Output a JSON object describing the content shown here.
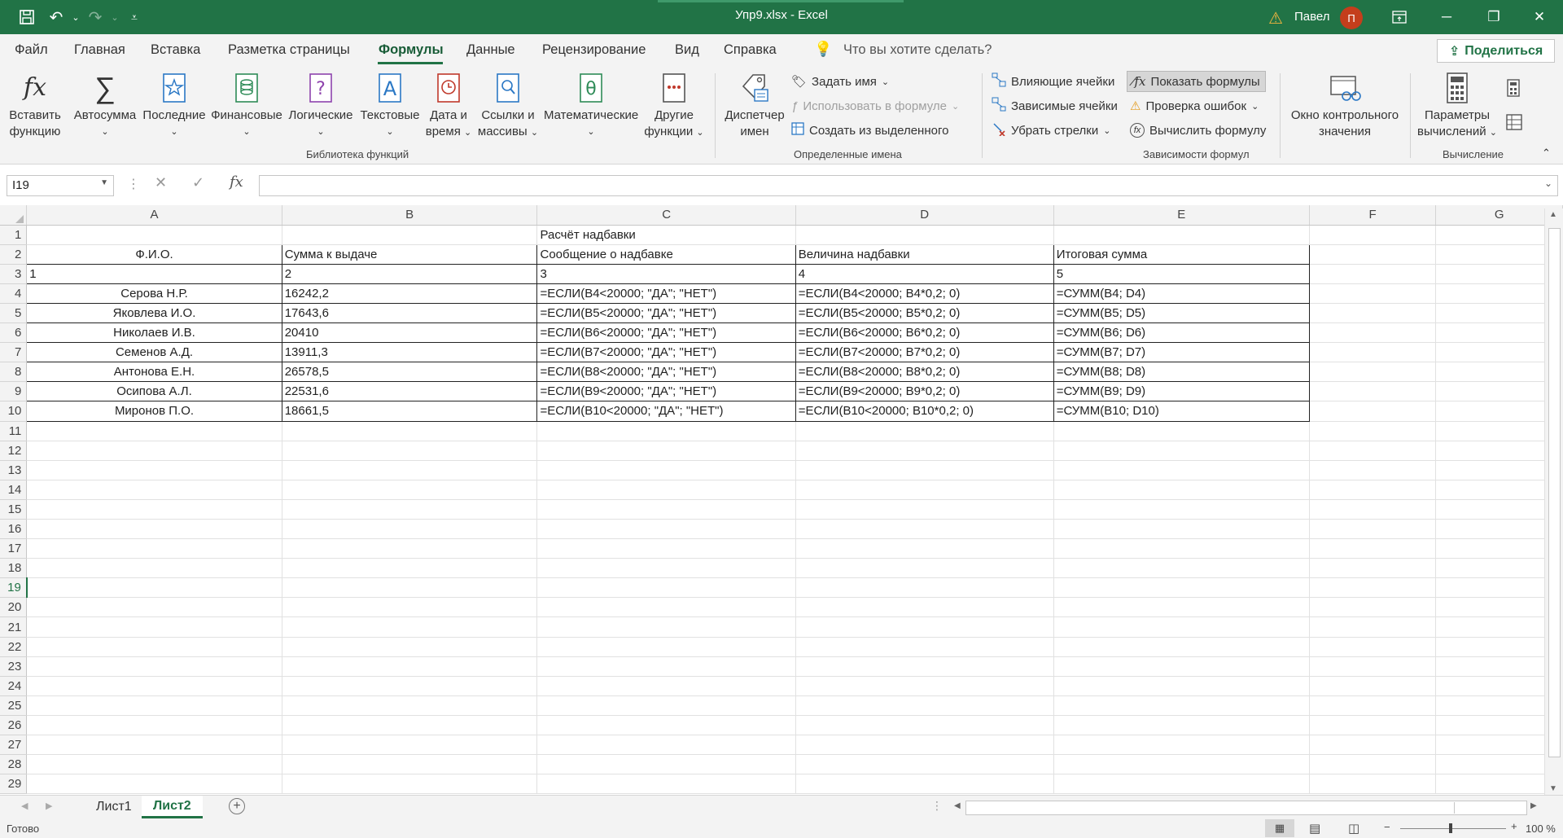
{
  "window": {
    "title": "Упр9.xlsx  -  Excel",
    "user_name": "Павел",
    "user_initial": "П"
  },
  "menu": {
    "tabs": [
      "Файл",
      "Главная",
      "Вставка",
      "Разметка страницы",
      "Формулы",
      "Данные",
      "Рецензирование",
      "Вид",
      "Справка"
    ],
    "active_tab": "Формулы",
    "search_placeholder": "Что вы хотите сделать?",
    "share_label": "Поделиться"
  },
  "ribbon": {
    "library": {
      "insert_function": [
        "Вставить",
        "функцию"
      ],
      "autosum": "Автосумма",
      "recent": "Последние",
      "financial": "Финансовые",
      "logical": "Логические",
      "text": "Текстовые",
      "datetime": [
        "Дата и",
        "время"
      ],
      "lookup": [
        "Ссылки и",
        "массивы"
      ],
      "math": "Математические",
      "more": [
        "Другие",
        "функции"
      ],
      "group_label": "Библиотека функций"
    },
    "names": {
      "manager": [
        "Диспетчер",
        "имен"
      ],
      "define_name": "Задать имя",
      "use_in_formula": "Использовать в формуле",
      "create_from_selection": "Создать из выделенного",
      "group_label": "Определенные имена"
    },
    "auditing": {
      "trace_precedents": "Влияющие ячейки",
      "trace_dependents": "Зависимые ячейки",
      "remove_arrows": "Убрать стрелки",
      "show_formulas": "Показать формулы",
      "error_checking": "Проверка ошибок",
      "evaluate_formula": "Вычислить формулу",
      "watch_window": [
        "Окно контрольного",
        "значения"
      ],
      "group_label": "Зависимости формул"
    },
    "calculation": {
      "options": [
        "Параметры",
        "вычислений"
      ],
      "group_label": "Вычисление"
    }
  },
  "formula_bar": {
    "name_box": "I19",
    "formula": ""
  },
  "sheet": {
    "columns": [
      "A",
      "B",
      "C",
      "D",
      "E",
      "F",
      "G"
    ],
    "title_cell": "Расчёт надбавки",
    "headers": [
      "Ф.И.О.",
      "Сумма к выдаче",
      "Сообщение о надбавке",
      "Величина надбавки",
      "Итоговая сумма"
    ],
    "numbers": [
      "1",
      "2",
      "3",
      "4",
      "5"
    ],
    "rows": [
      [
        "Серова Н.Р.",
        "16242,2",
        "=ЕСЛИ(B4<20000; \"ДА\"; \"НЕТ\")",
        "=ЕСЛИ(B4<20000; B4*0,2; 0)",
        "=СУММ(B4; D4)"
      ],
      [
        "Яковлева И.О.",
        "17643,6",
        "=ЕСЛИ(B5<20000; \"ДА\"; \"НЕТ\")",
        "=ЕСЛИ(B5<20000; B5*0,2; 0)",
        "=СУММ(B5; D5)"
      ],
      [
        "Николаев И.В.",
        "20410",
        "=ЕСЛИ(B6<20000; \"ДА\"; \"НЕТ\")",
        "=ЕСЛИ(B6<20000; B6*0,2; 0)",
        "=СУММ(B6; D6)"
      ],
      [
        "Семенов А.Д.",
        "13911,3",
        "=ЕСЛИ(B7<20000; \"ДА\"; \"НЕТ\")",
        "=ЕСЛИ(B7<20000; B7*0,2; 0)",
        "=СУММ(B7; D7)"
      ],
      [
        "Антонова Е.Н.",
        "26578,5",
        "=ЕСЛИ(B8<20000; \"ДА\"; \"НЕТ\")",
        "=ЕСЛИ(B8<20000; B8*0,2; 0)",
        "=СУММ(B8; D8)"
      ],
      [
        "Осипова А.Л.",
        "22531,6",
        "=ЕСЛИ(B9<20000; \"ДА\"; \"НЕТ\")",
        "=ЕСЛИ(B9<20000; B9*0,2; 0)",
        "=СУММ(B9; D9)"
      ],
      [
        "Миронов П.О.",
        "18661,5",
        "=ЕСЛИ(B10<20000; \"ДА\"; \"НЕТ\")",
        "=ЕСЛИ(B10<20000; B10*0,2; 0)",
        "=СУММ(B10; D10)"
      ]
    ],
    "selected_row": "19"
  },
  "sheet_tabs": [
    "Лист1",
    "Лист2"
  ],
  "active_sheet": "Лист2",
  "status": {
    "ready": "Готово",
    "zoom": "100 %"
  },
  "colors": {
    "accent": "#217346",
    "avatar": "#c43e1c"
  }
}
